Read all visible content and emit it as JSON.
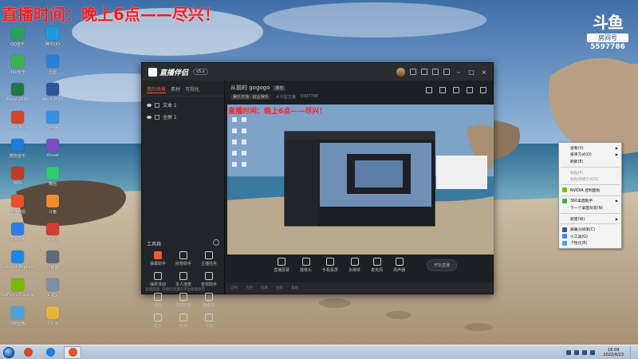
{
  "overlay": {
    "title": "直播时间：晚上6点——尽兴！"
  },
  "brand_badge": {
    "logo": "斗鱼",
    "subtitle": "房间号",
    "room_number": "5597786"
  },
  "desktop_icons": [
    {
      "label": "QQ音乐",
      "color": "#2aa15a"
    },
    {
      "label": "腾讯QQ",
      "color": "#1f9be0"
    },
    {
      "label": "360安全",
      "color": "#3bb34a"
    },
    {
      "label": "迅雷",
      "color": "#2a7fd8"
    },
    {
      "label": "Excel 2016",
      "color": "#1d7a44"
    },
    {
      "label": "Word 2016",
      "color": "#2b579a"
    },
    {
      "label": "PowerPoint",
      "color": "#d24726"
    },
    {
      "label": "浏览器",
      "color": "#3a8fe0"
    },
    {
      "label": "酷狗音乐",
      "color": "#1c7ed6"
    },
    {
      "label": "Visual",
      "color": "#7a4cc2"
    },
    {
      "label": "WPS",
      "color": "#c0392b"
    },
    {
      "label": "微信",
      "color": "#2ecc71"
    },
    {
      "label": "直播伴侣",
      "color": "#e8522f"
    },
    {
      "label": "斗鱼",
      "color": "#f08c2b"
    },
    {
      "label": "百度网盘",
      "color": "#2f7de1"
    },
    {
      "label": "网易云",
      "color": "#d33a31"
    },
    {
      "label": "Internet Explorer",
      "color": "#1e88e5"
    },
    {
      "label": "计算器",
      "color": "#5f6b7a"
    },
    {
      "label": "GeForce Experience",
      "color": "#76b900"
    },
    {
      "label": "回收站",
      "color": "#7f8fa6"
    },
    {
      "label": "控制面板",
      "color": "#4aa3df"
    },
    {
      "label": "文件夹",
      "color": "#e8b43a"
    }
  ],
  "app": {
    "name": "直播伴侣",
    "version": "v5.x",
    "left_tabs": [
      "我的场景",
      "素材",
      "可视化"
    ],
    "scenes": [
      {
        "label": "文本 1"
      },
      {
        "label": "全屏 1"
      }
    ],
    "toolbox_title": "工具箱",
    "tools": [
      {
        "label": "弹幕助手",
        "highlight": true
      },
      {
        "label": "房管助手",
        "highlight": false
      },
      {
        "label": "主播任务",
        "highlight": false
      },
      {
        "label": "抽奖活动",
        "highlight": false
      },
      {
        "label": "多人连麦",
        "highlight": false
      },
      {
        "label": "音效助手",
        "highlight": false
      },
      {
        "label": "录屏",
        "highlight": false
      },
      {
        "label": "虚拟形象",
        "highlight": false
      },
      {
        "label": "弹幕库",
        "highlight": false
      },
      {
        "label": "更多",
        "highlight": false
      },
      {
        "label": "礼物",
        "highlight": false
      },
      {
        "label": "下载",
        "highlight": false
      }
    ],
    "left_status": "直播提醒: 开播后请遵守平台直播规范",
    "room_title": "从前的 gogogo",
    "room_tag": "推荐",
    "room_category": "娱乐天地 · 综合娱乐",
    "room_meta": [
      "大众型主播",
      "5597786"
    ],
    "controls": [
      {
        "label": "直播屏幕"
      },
      {
        "label": "摄像头"
      },
      {
        "label": "手机投屏"
      },
      {
        "label": "多媒体"
      },
      {
        "label": "麦克风"
      },
      {
        "label": "扬声器"
      }
    ],
    "start_label": "开始直播",
    "status_items": [
      "CPU",
      "内存",
      "码率",
      "帧率",
      "丢帧"
    ]
  },
  "context_menu": [
    {
      "label": "查看(V)",
      "submenu": true,
      "disabled": false
    },
    {
      "label": "排序方式(O)",
      "submenu": true,
      "disabled": false
    },
    {
      "label": "刷新(E)",
      "submenu": false,
      "disabled": false
    },
    {
      "sep": true
    },
    {
      "label": "粘贴(P)",
      "submenu": false,
      "disabled": true
    },
    {
      "label": "粘贴快捷方式(S)",
      "submenu": false,
      "disabled": true
    },
    {
      "sep": true
    },
    {
      "label": "NVIDIA 控制面板",
      "submenu": false,
      "disabled": false,
      "icon": "#76b900"
    },
    {
      "sep": true
    },
    {
      "label": "360桌面助手",
      "submenu": true,
      "disabled": false,
      "icon": "#3bb34a"
    },
    {
      "label": "下一个桌面背景(N)",
      "submenu": false,
      "disabled": false
    },
    {
      "sep": true
    },
    {
      "label": "新建(W)",
      "submenu": true,
      "disabled": false
    },
    {
      "sep": true
    },
    {
      "label": "屏幕分辨率(C)",
      "submenu": false,
      "disabled": false,
      "icon": "#2b579a"
    },
    {
      "label": "小工具(G)",
      "submenu": false,
      "disabled": false,
      "icon": "#3a8fe0"
    },
    {
      "label": "个性化(R)",
      "submenu": false,
      "disabled": false,
      "icon": "#4aa3df"
    }
  ],
  "taskbar": {
    "apps": [
      {
        "name": "start",
        "color": "#1d5fb0"
      },
      {
        "name": "user-app",
        "color": "#d24726"
      },
      {
        "name": "kugou",
        "color": "#1c7ed6"
      },
      {
        "name": "live-companion",
        "color": "#e8522f"
      }
    ],
    "clock_time": "18:09",
    "clock_date": "2022/4/23"
  }
}
